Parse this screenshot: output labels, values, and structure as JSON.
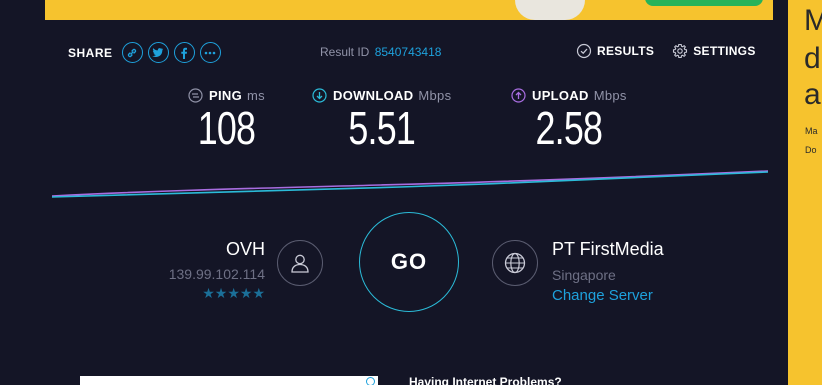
{
  "share": {
    "label": "SHARE",
    "icons": [
      "link-icon",
      "twitter-icon",
      "facebook-icon",
      "more-icon"
    ]
  },
  "result": {
    "label": "Result ID",
    "id": "8540743418"
  },
  "nav": {
    "results": "RESULTS",
    "settings": "SETTINGS"
  },
  "metrics": {
    "ping": {
      "label": "PING",
      "unit": "ms",
      "value": "108"
    },
    "download": {
      "label": "DOWNLOAD",
      "unit": "Mbps",
      "value": "5.51"
    },
    "upload": {
      "label": "UPLOAD",
      "unit": "Mbps",
      "value": "2.58"
    }
  },
  "isp": {
    "name": "OVH",
    "ip": "139.99.102.114",
    "stars": "★★★★★",
    "rating": 5
  },
  "go": {
    "label": "GO"
  },
  "server": {
    "name": "PT FirstMedia",
    "location": "Singapore",
    "change": "Change Server"
  },
  "ad": {
    "big_letters": [
      "M",
      "d",
      "a"
    ],
    "small_lines": [
      "Ma",
      "Do"
    ]
  },
  "bottom": {
    "problems": "Having Internet Problems?"
  },
  "colors": {
    "accent": "#1ea1dc",
    "download": "#2bbbd8",
    "upload": "#a86de0",
    "banner": "#f6c32e",
    "background": "#141526"
  }
}
